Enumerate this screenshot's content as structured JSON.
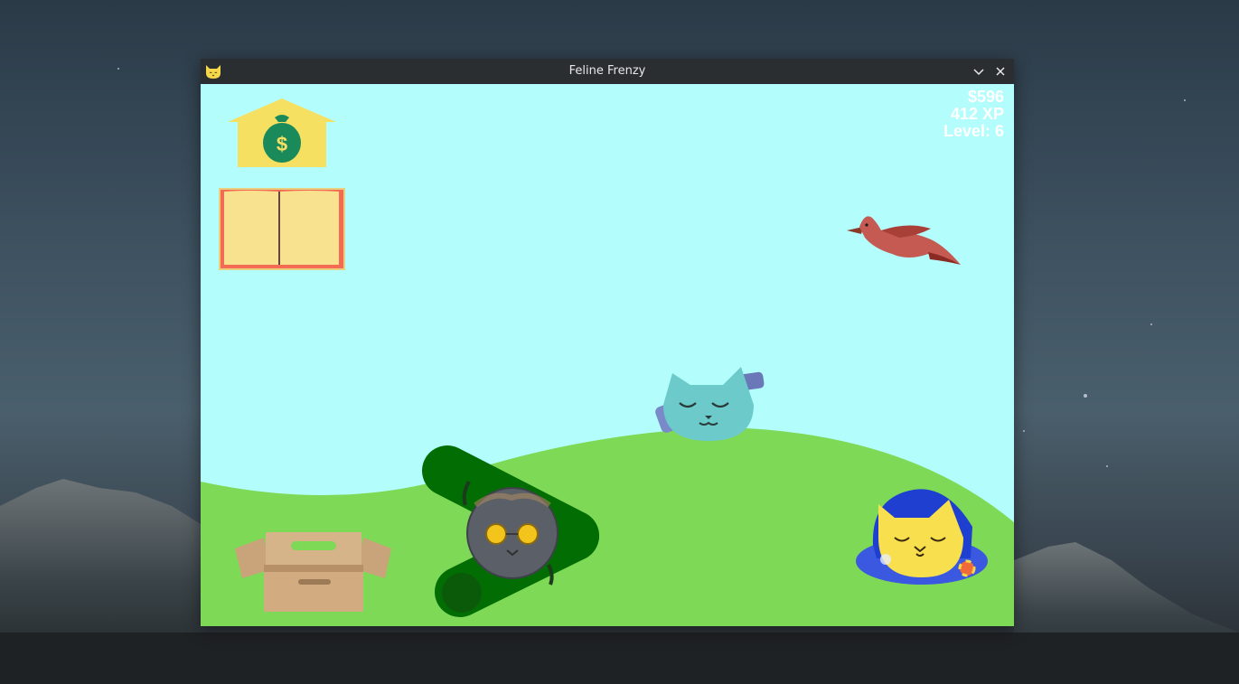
{
  "window": {
    "title": "Feline Frenzy",
    "controls": [
      "minimize-icon",
      "close-icon"
    ],
    "app_icon": "cat-face-icon"
  },
  "hud": {
    "money": "$596",
    "xp": "412 XP",
    "level": "Level: 6"
  },
  "sprites": {
    "shop": "money-bag-house-icon",
    "book": "open-book-icon",
    "bird": "cardinal-bird",
    "box": "cardboard-box",
    "tube": "green-tunnel-toy",
    "cat_cool": "gray-cat-with-sunglasses",
    "cat_bottle": "teal-cat-with-bottle",
    "cat_bed": "yellow-cat-in-blue-bed"
  },
  "colors": {
    "sky": "#b3fefd",
    "grass": "#7ed957",
    "titlebar": "#2b2e31",
    "hud_text": "#ffffff"
  }
}
